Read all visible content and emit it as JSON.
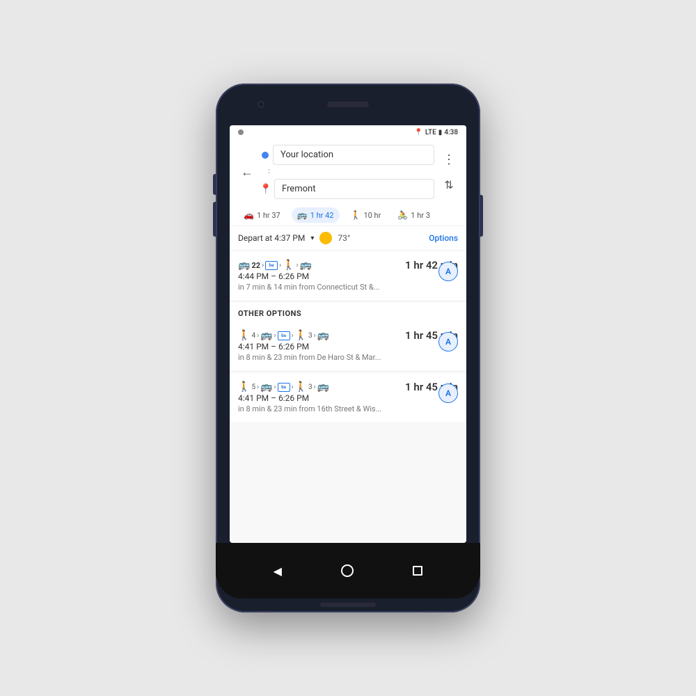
{
  "phone": {
    "statusBar": {
      "time": "4:38",
      "signal": "LTE",
      "batteryIcon": "🔋"
    },
    "header": {
      "backLabel": "←",
      "moreLabel": "⋮",
      "swapLabel": "⇅",
      "origin": {
        "placeholder": "Your location",
        "dotColor": "#4285f4"
      },
      "destination": {
        "placeholder": "Fremont",
        "pinColor": "#e53935"
      }
    },
    "transportTabs": [
      {
        "id": "drive",
        "icon": "🚗",
        "label": "1 hr 37",
        "active": false
      },
      {
        "id": "transit",
        "icon": "🚌",
        "label": "1 hr 42",
        "active": true
      },
      {
        "id": "walk",
        "icon": "🚶",
        "label": "10 hr",
        "active": false
      },
      {
        "id": "bike",
        "icon": "🚴",
        "label": "1 hr 3",
        "active": false
      }
    ],
    "departBar": {
      "departText": "Depart at 4:37 PM",
      "dropdownArrow": "▾",
      "temperature": "73°",
      "optionsLabel": "Options"
    },
    "mainRoute": {
      "icons": [
        "🚌",
        "22",
        "ba",
        "🚶",
        "🚌"
      ],
      "duration": "1 hr 42 min",
      "timeRange": "4:44 PM – 6:26 PM",
      "detail": "in 7 min & 14 min from Connecticut St &...",
      "avatarLabel": "A"
    },
    "otherOptionsLabel": "OTHER OPTIONS",
    "otherRoutes": [
      {
        "walkBadge": "4",
        "bartBadge": "",
        "walkBadge2": "3",
        "duration": "1 hr 45 min",
        "timeRange": "4:41 PM – 6:26 PM",
        "detail": "in 8 min & 23 min from De Haro St & Mar...",
        "avatarLabel": "A"
      },
      {
        "walkBadge": "5",
        "bartBadge": "",
        "walkBadge2": "3",
        "duration": "1 hr 45 min",
        "timeRange": "4:41 PM – 6:26 PM",
        "detail": "in 8 min & 23 min from 16th Street & Wis...",
        "avatarLabel": "A"
      }
    ],
    "navButtons": {
      "back": "◀",
      "home": "",
      "recents": ""
    }
  }
}
